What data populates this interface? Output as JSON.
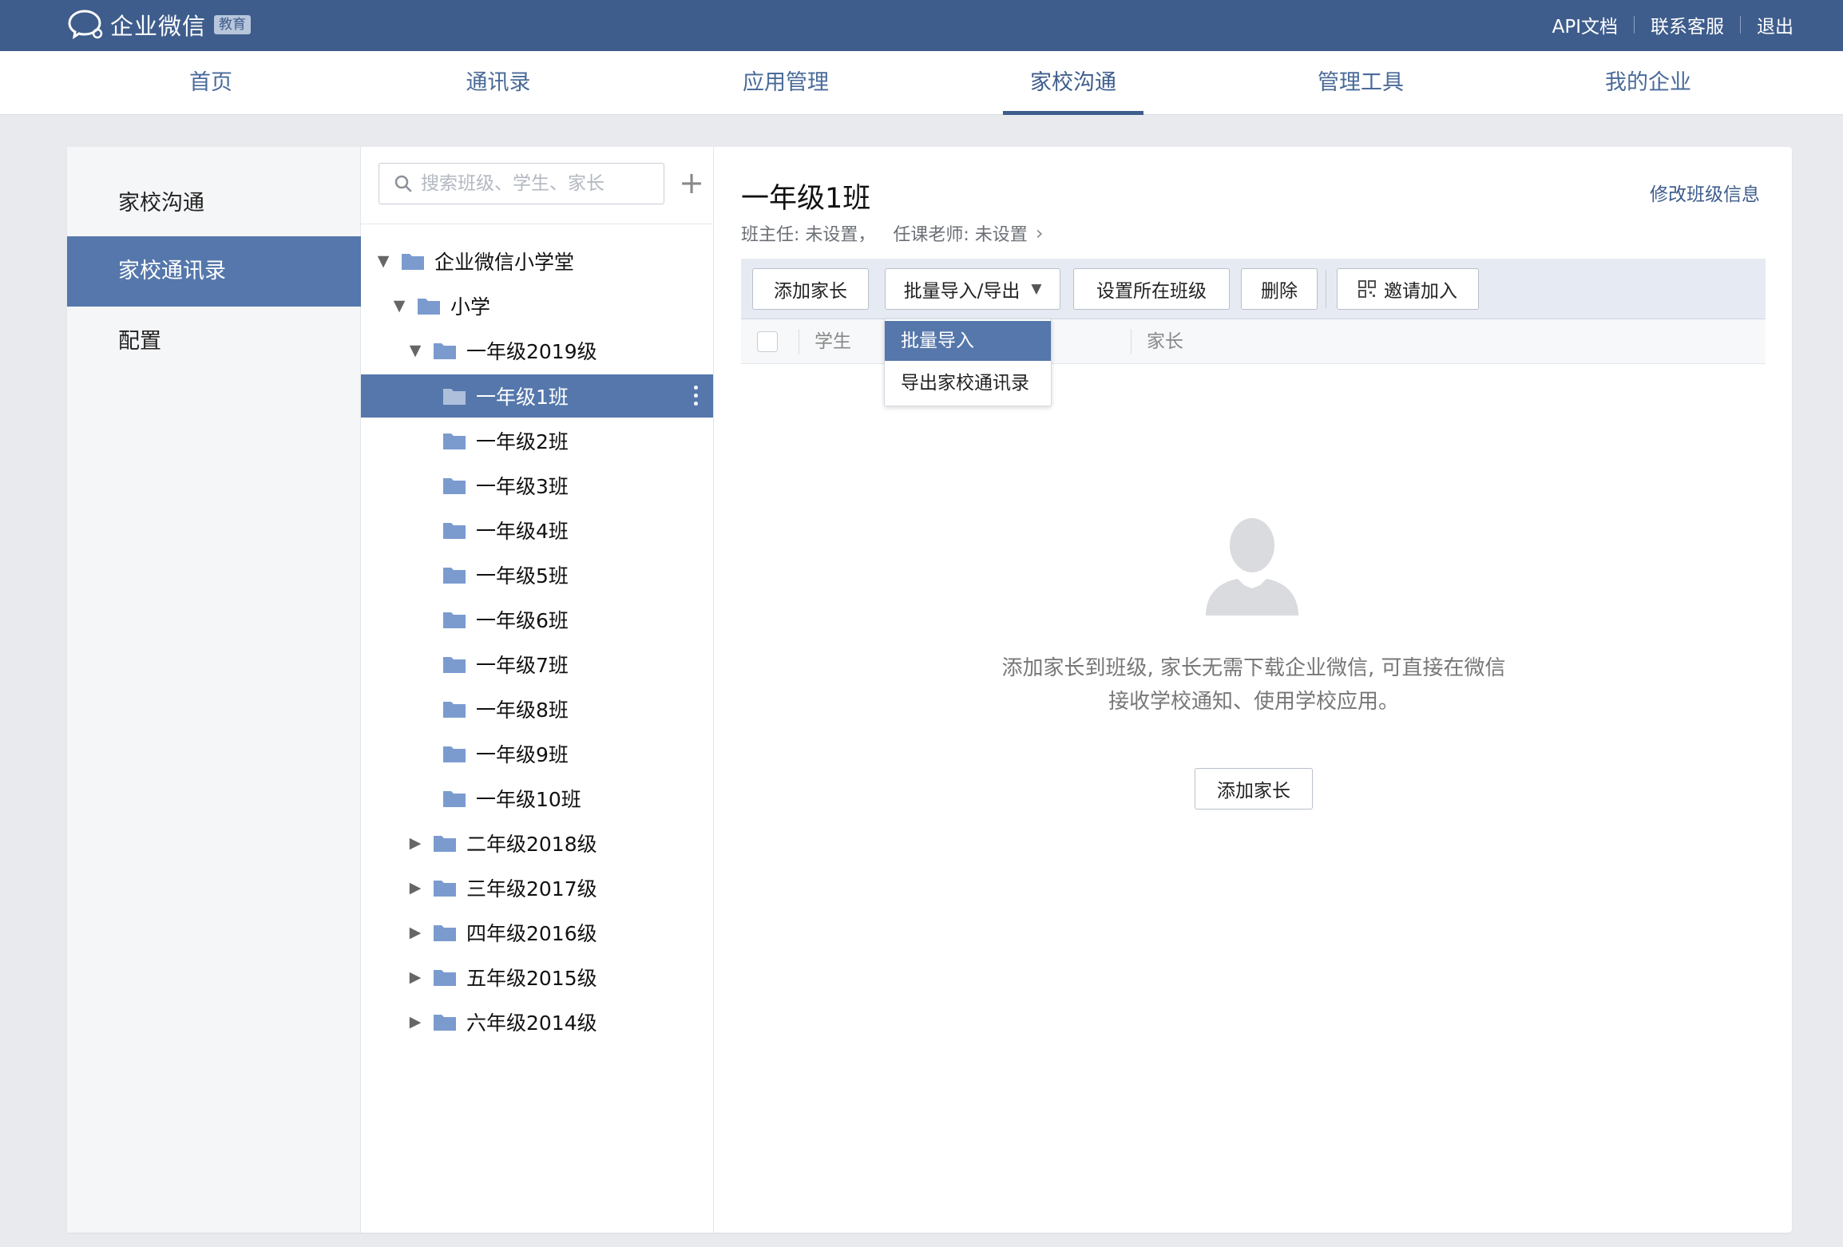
{
  "app": {
    "name": "企业微信",
    "badge": "教育"
  },
  "top_links": [
    "API文档",
    "联系客服",
    "退出"
  ],
  "nav": [
    {
      "label": "首页",
      "active": false
    },
    {
      "label": "通讯录",
      "active": false
    },
    {
      "label": "应用管理",
      "active": false
    },
    {
      "label": "家校沟通",
      "active": true
    },
    {
      "label": "管理工具",
      "active": false
    },
    {
      "label": "我的企业",
      "active": false
    }
  ],
  "sidebar": [
    {
      "label": "家校沟通",
      "active": false
    },
    {
      "label": "家校通讯录",
      "active": true
    },
    {
      "label": "配置",
      "active": false
    }
  ],
  "search": {
    "placeholder": "搜索班级、学生、家长"
  },
  "tree": {
    "root": "企业微信小学堂",
    "level1": "小学",
    "grade": "一年级2019级",
    "classes": [
      "一年级1班",
      "一年级2班",
      "一年级3班",
      "一年级4班",
      "一年级5班",
      "一年级6班",
      "一年级7班",
      "一年级8班",
      "一年级9班",
      "一年级10班"
    ],
    "other_grades": [
      "二年级2018级",
      "三年级2017级",
      "四年级2016级",
      "五年级2015级",
      "六年级2014级"
    ]
  },
  "content": {
    "title": "一年级1班",
    "edit_link": "修改班级信息",
    "head_teacher": "班主任: 未设置，",
    "subject_teacher": "任课老师: 未设置"
  },
  "toolbar": {
    "add_parent": "添加家长",
    "import_export": "批量导入/导出",
    "set_class": "设置所在班级",
    "delete": "删除",
    "invite": "邀请加入"
  },
  "table": {
    "col_student": "学生",
    "col_parent": "家长"
  },
  "dropdown": [
    "批量导入",
    "导出家校通讯录"
  ],
  "empty": {
    "line1": "添加家长到班级, 家长无需下载企业微信, 可直接在微信",
    "line2": "接收学校通知、使用学校应用。",
    "button": "添加家长"
  },
  "colors": {
    "primary": "#3e5d8c",
    "accent": "#5577ab",
    "folder": "#7b9bcf"
  }
}
